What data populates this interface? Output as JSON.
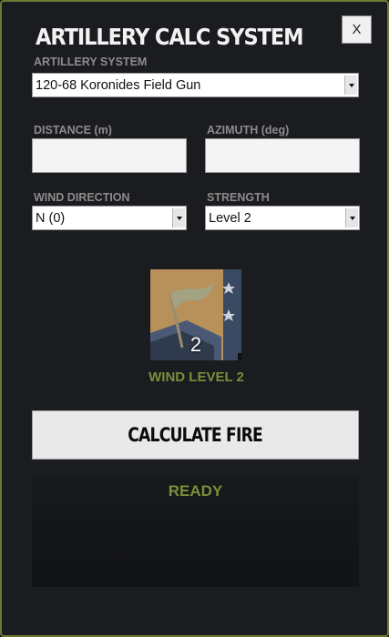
{
  "window": {
    "title": "ARTILLERY CALC SYSTEM",
    "close_label": "X"
  },
  "artillery": {
    "label": "ARTILLERY SYSTEM",
    "selected": "120-68 Koronides Field Gun"
  },
  "distance": {
    "label": "DISTANCE (m)",
    "value": ""
  },
  "azimuth": {
    "label": "AZIMUTH (deg)",
    "value": ""
  },
  "wind_direction": {
    "label": "WIND DIRECTION",
    "selected": "N (0)"
  },
  "strength": {
    "label": "STRENGTH",
    "selected": "Level 2"
  },
  "wind_indicator": {
    "level_number": "2",
    "caption": "WIND LEVEL 2"
  },
  "calculate_button": {
    "label": "CALCULATE FIRE"
  },
  "output": {
    "status": "READY"
  },
  "colors": {
    "accent_green": "#7a8e3c",
    "border_green": "#6b7a33",
    "background": "#1a1c1f"
  }
}
